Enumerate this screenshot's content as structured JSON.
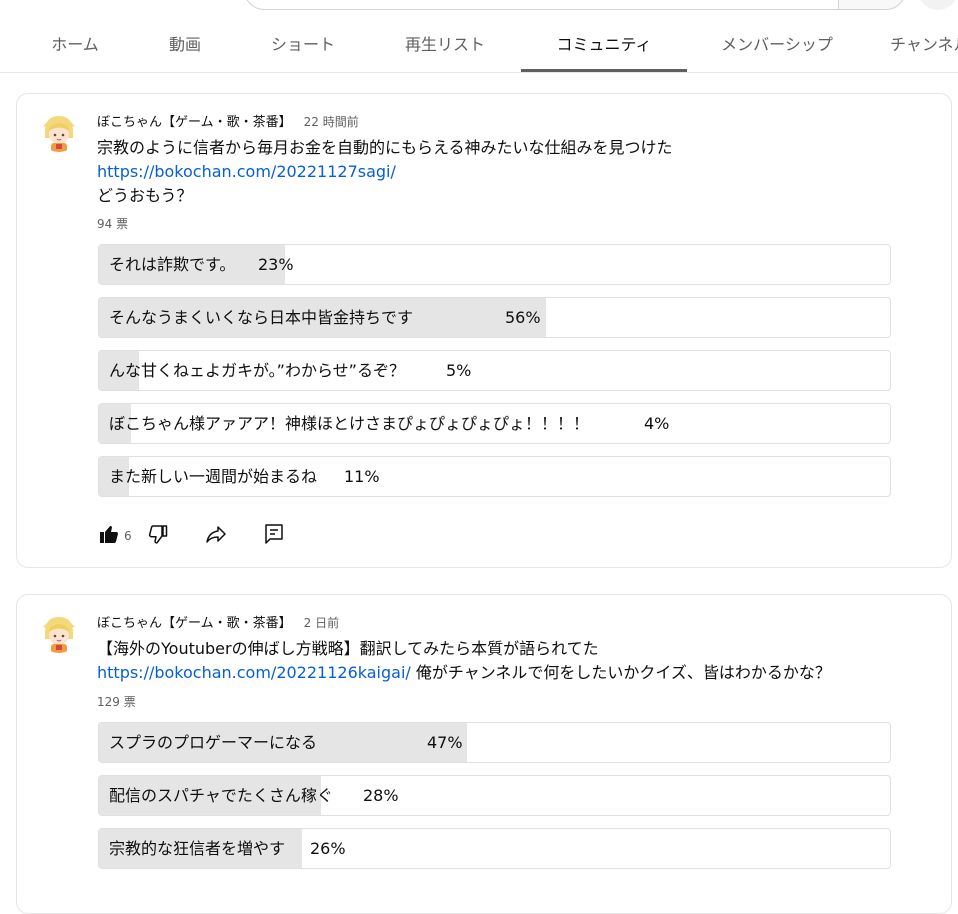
{
  "tabs": [
    {
      "label": "ホーム"
    },
    {
      "label": "動画"
    },
    {
      "label": "ショート"
    },
    {
      "label": "再生リスト"
    },
    {
      "label": "コミュニティ"
    },
    {
      "label": "メンバーシップ"
    },
    {
      "label": "チャンネル"
    }
  ],
  "active_tab": "コミュニティ",
  "posts": [
    {
      "author": "ぼこちゃん【ゲーム・歌・茶番】",
      "time": "22 時間前",
      "text_line1": "宗教のように信者から毎月お金を自動的にもらえる神みたいな仕組みを見つけた",
      "link": "https://bokochan.com/20221127sagi/",
      "text_line3": "どうおもう？",
      "votes": "94 票",
      "options": [
        {
          "label": "それは詐欺です。",
          "percent_text": "23%",
          "percent": 23
        },
        {
          "label": "そんなうまくいくなら日本中皆金持ちです",
          "percent_text": "56%",
          "percent": 56
        },
        {
          "label": "んな甘くねェよガキが。”わからせ”るぞ？",
          "percent_text": "5%",
          "percent": 5
        },
        {
          "label": "ぼこちゃん様アァアア！神様ほとけさまぴょぴょぴょぴょ！！！！",
          "percent_text": "4%",
          "percent": 4
        },
        {
          "label": "また新しい一週間が始まるね",
          "percent_text": "11%",
          "percent": 11
        }
      ],
      "likes": "6"
    },
    {
      "author": "ぼこちゃん【ゲーム・歌・茶番】",
      "time": "2 日前",
      "text_line1": "【海外のYoutuberの伸ばし方戦略】翻訳してみたら本質が語られてた",
      "link": "https://bokochan.com/20221126kaigai/",
      "text_after_link": " 俺がチャンネルで何をしたいかクイズ、皆はわかるかな？",
      "votes": "129 票",
      "options": [
        {
          "label": "スプラのプロゲーマーになる",
          "percent_text": "47%",
          "percent": 47
        },
        {
          "label": "配信のスパチャでたくさん稼ぐ",
          "percent_text": "28%",
          "percent": 28
        },
        {
          "label": "宗教的な狂信者を増やす",
          "percent_text": "26%",
          "percent": 26
        }
      ]
    }
  ],
  "colors": {
    "link": "#065fd4",
    "poll_fill": "#e5e5e5",
    "tab_indicator": "#606060",
    "muted_text": "#606060"
  },
  "icons": [
    "like-icon",
    "dislike-icon",
    "share-icon",
    "comment-icon"
  ]
}
